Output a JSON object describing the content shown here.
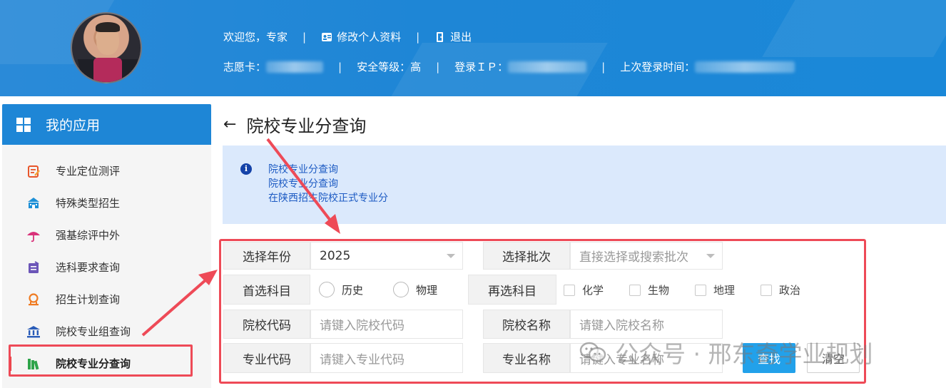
{
  "header": {
    "welcome": "欢迎您，专家",
    "edit_profile": "修改个人资料",
    "logout": "退出",
    "card_label": "志愿卡：",
    "security_label": "安全等级：高",
    "ip_label": "登录ＩＰ：",
    "last_login_label": "上次登录时间："
  },
  "sidebar": {
    "title": "我的应用",
    "items": [
      {
        "label": "专业定位测评",
        "icon": "assessment-icon",
        "color": "#e8562a"
      },
      {
        "label": "特殊类型招生",
        "icon": "school-icon",
        "color": "#1c8fd6"
      },
      {
        "label": "强基综评中外",
        "icon": "umbrella-icon",
        "color": "#d9327a"
      },
      {
        "label": "选科要求查询",
        "icon": "document-icon",
        "color": "#6c56b8"
      },
      {
        "label": "招生计划查询",
        "icon": "search-plan-icon",
        "color": "#ef7b22"
      },
      {
        "label": "院校专业组查询",
        "icon": "institution-icon",
        "color": "#2a5cb8"
      },
      {
        "label": "院校专业分查询",
        "icon": "books-icon",
        "color": "#2ea44a"
      }
    ]
  },
  "page": {
    "title": "院校专业分查询",
    "info_lines": [
      "院校专业分查询",
      "院校专业分查询",
      "在陕西招生院校正式专业分"
    ]
  },
  "form": {
    "year_label": "选择年份",
    "year_value": "2025",
    "batch_label": "选择批次",
    "batch_placeholder": "直接选择或搜索批次",
    "first_subject_label": "首选科目",
    "first_subject_options": [
      "历史",
      "物理"
    ],
    "second_subject_label": "再选科目",
    "second_subject_options": [
      "化学",
      "生物",
      "地理",
      "政治"
    ],
    "school_code_label": "院校代码",
    "school_code_placeholder": "请键入院校代码",
    "school_name_label": "院校名称",
    "school_name_placeholder": "请键入院校名称",
    "major_code_label": "专业代码",
    "major_code_placeholder": "请键入专业代码",
    "major_name_label": "专业名称",
    "major_name_placeholder": "请键入专业名称",
    "search_button": "查找",
    "clear_button": "清空"
  },
  "watermark": {
    "text": "公众号 · 邢东奇学业规划"
  },
  "colors": {
    "brand_blue": "#1e86d6",
    "highlight_red": "#ee4a57",
    "info_bg": "#dbe9fc",
    "button_blue": "#22a1ea"
  }
}
